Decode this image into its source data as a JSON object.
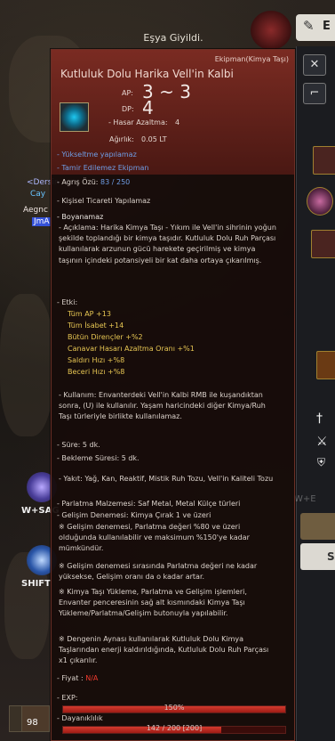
{
  "notification": "Eşya Giyildi.",
  "top_tab": {
    "icon": "wand-icon",
    "label": "E"
  },
  "left_hud": {
    "tag1": "<Dersin",
    "tag2": "Cay",
    "tag3": "Aegnc",
    "tag4": "JmA",
    "skill1_label": "W+SAG",
    "skill2_label": "SHIFT",
    "slot_count": "98"
  },
  "right_hud": {
    "btn1_label": "S",
    "side_text": "W+E"
  },
  "tooltip": {
    "category": "Ekipman(Kimya Taşı)",
    "name": "Kutluluk Dolu Harika Vell'in Kalbi",
    "ap_label": "AP:",
    "ap_value": "3 ~ 3",
    "dp_label": "DP:",
    "dp_value": "4",
    "damage_reduction_label": "- Hasar Azaltma:",
    "damage_reduction_value": "4",
    "weight_label": "Ağırlık:",
    "weight_value": "0.05 LT",
    "upgrade_note": "- Yükseltme yapılamaz",
    "repair_note": "- Tamir Edilemez Ekipman",
    "soul_label": "- Agrış Özü:",
    "soul_value": "83 / 250",
    "trade_note": "- Kişisel Ticareti Yapılamaz",
    "dye_note": "- Boyanamaz",
    "description": "- Açıklama: Harika Kimya Taşı - Yıkım ile Vell'in sihrinin yoğun şekilde toplandığı bir kimya taşıdır. Kutluluk Dolu Ruh Parçası kullanılarak arzunun gücü harekete geçirilmiş ve kimya taşının içindeki potansiyeli bir kat daha ortaya çıkarılmış.",
    "effect_title": "- Etki:",
    "effects": [
      "Tüm AP +13",
      "Tüm İsabet +14",
      "Bütün Dirençler +%2",
      "Canavar Hasarı Azaltma Oranı +%1",
      "Saldırı Hızı +%8",
      "Beceri Hızı +%8"
    ],
    "usage": "- Kullanım: Envanterdeki Vell'in Kalbi RMB ile kuşandıktan sonra, (U) ile kullanılır. Yaşam haricindeki diğer Kimya/Ruh Taşı türleriyle birlikte kullanılamaz.",
    "duration": "- Süre: 5 dk.",
    "cooldown": "- Bekleme Süresi: 5 dk.",
    "fuel": "- Yakıt: Yağ, Kan, Reaktif, Mistik Ruh Tozu, Vell'in Kaliteli Tozu",
    "polish_material": "- Parlatma Malzemesi: Saf Metal, Metal Külçe türleri",
    "growth_attempt": "- Gelişim Denemesi: Kimya Çırak 1 ve üzeri",
    "note1": "※ Gelişim denemesi, Parlatma değeri %80 ve üzeri olduğunda kullanılabilir ve maksimum %150'ye kadar mümkündür.",
    "note2": "※ Gelişim denemesi sırasında Parlatma değeri ne kadar yüksekse, Gelişim oranı da o kadar artar.",
    "note3": "※ Kimya Taşı Yükleme, Parlatma ve Gelişim işlemleri, Envanter penceresinin sağ alt kısmındaki Kimya Taşı Yükleme/Parlatma/Gelişim butonuyla yapılabilir.",
    "warning": "※ Dengenin Aynası kullanılarak Kutluluk Dolu Kimya Taşlarından enerji kaldırıldığında, Kutluluk Dolu Ruh Parçası x1 çıkarılır.",
    "price_label": "- Fiyat :",
    "price_value": "N/A",
    "exp_label": "- EXP:",
    "exp_value": "150%",
    "exp_fill": 1.0,
    "durability_label": "- Dayanıklılık",
    "durability_value": "142 / 200 [200]",
    "durability_fill": 0.71
  },
  "colors": {
    "header": "#7a2b22",
    "blue_text": "#6f9ee6",
    "gold_text": "#e7c653",
    "red_text": "#ef3a2e"
  }
}
